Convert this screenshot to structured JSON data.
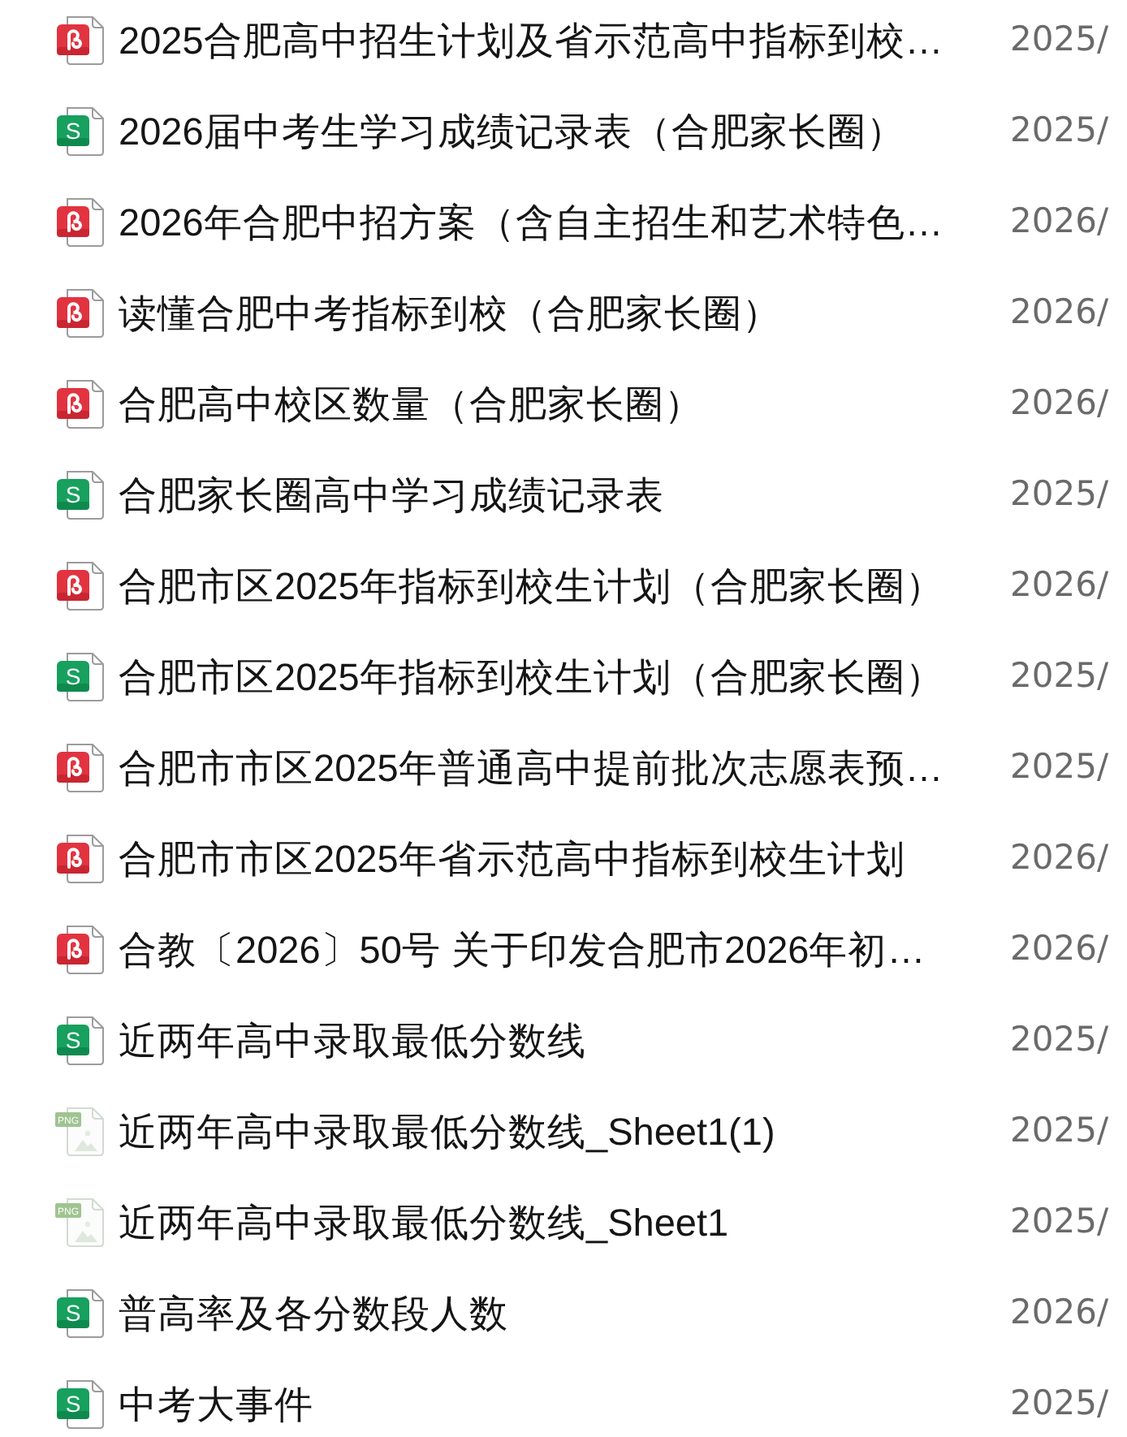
{
  "files": [
    {
      "kind": "pdf",
      "name": "2025合肥高中招生计划及省示范高中指标到校…",
      "date": "2025/"
    },
    {
      "kind": "sheet",
      "icon_text": "S",
      "name": "2026届中考生学习成绩记录表（合肥家长圈）",
      "date": "2025/"
    },
    {
      "kind": "pdf",
      "name": "2026年合肥中招方案（含自主招生和艺术特色…",
      "date": "2026/"
    },
    {
      "kind": "pdf",
      "name": "读懂合肥中考指标到校（合肥家长圈）",
      "date": "2026/"
    },
    {
      "kind": "pdf",
      "name": "合肥高中校区数量（合肥家长圈）",
      "date": "2026/"
    },
    {
      "kind": "sheet",
      "icon_text": "S",
      "name": "合肥家长圈高中学习成绩记录表",
      "date": "2025/"
    },
    {
      "kind": "pdf",
      "name": "合肥市区2025年指标到校生计划（合肥家长圈）",
      "date": "2026/"
    },
    {
      "kind": "sheet",
      "icon_text": "S",
      "name": "合肥市区2025年指标到校生计划（合肥家长圈）",
      "date": "2025/"
    },
    {
      "kind": "pdf",
      "name": "合肥市市区2025年普通高中提前批次志愿表预…",
      "date": "2025/"
    },
    {
      "kind": "pdf",
      "name": "合肥市市区2025年省示范高中指标到校生计划",
      "date": "2026/"
    },
    {
      "kind": "pdf",
      "name": "合教〔2026〕50号 关于印发合肥市2026年初…",
      "date": "2026/"
    },
    {
      "kind": "sheet",
      "icon_text": "S",
      "name": "近两年高中录取最低分数线",
      "date": "2025/"
    },
    {
      "kind": "image",
      "icon_text": "PNG",
      "name": "近两年高中录取最低分数线_Sheet1(1)",
      "date": "2025/"
    },
    {
      "kind": "image",
      "icon_text": "PNG",
      "name": "近两年高中录取最低分数线_Sheet1",
      "date": "2025/"
    },
    {
      "kind": "sheet",
      "icon_text": "S",
      "name": "普高率及各分数段人数",
      "date": "2026/"
    },
    {
      "kind": "sheet",
      "icon_text": "S",
      "name": "中考大事件",
      "date": "2025/"
    }
  ]
}
